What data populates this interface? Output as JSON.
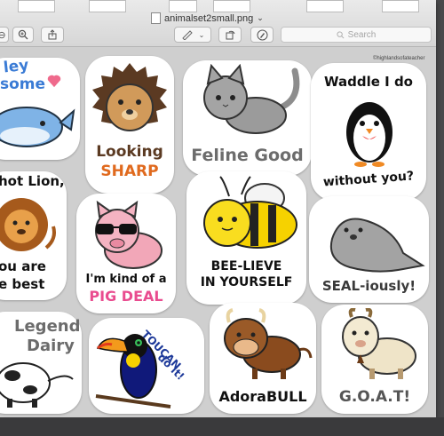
{
  "window": {
    "title": "animalset2small.png",
    "search_placeholder": "Search",
    "watermark": "©highlandsofateacher"
  },
  "toolbar": {
    "zoom_icon": "zoom-in-icon",
    "share_icon": "share-icon",
    "markup_icon": "pen-icon",
    "rotate_icon": "rotate-icon",
    "annotate_icon": "markup-circle-icon"
  },
  "stickers": {
    "whale": {
      "line1": "ley",
      "line2": "some"
    },
    "hedgehog": {
      "line1": "Looking",
      "line2": "SHARP"
    },
    "cat": {
      "text": "Feline Good"
    },
    "penguin": {
      "line1": "Waddle I do",
      "line2": "without you?"
    },
    "lion": {
      "line1": "hot Lion,",
      "line2": "ou are",
      "line3": "e best"
    },
    "pig": {
      "line1": "I'm kind of a",
      "line2": "PIG DEAL"
    },
    "bee": {
      "line1": "BEE-LIEVE",
      "line2": "IN YOURSELF"
    },
    "seal": {
      "text": "SEAL-iously!"
    },
    "cow": {
      "line1": "Legend",
      "line2": "Dairy"
    },
    "toucan": {
      "line1": "TOUCAN",
      "line2": "do it!"
    },
    "bull": {
      "text": "AdoraBULL"
    },
    "goat": {
      "text": "G.O.A.T!"
    }
  }
}
